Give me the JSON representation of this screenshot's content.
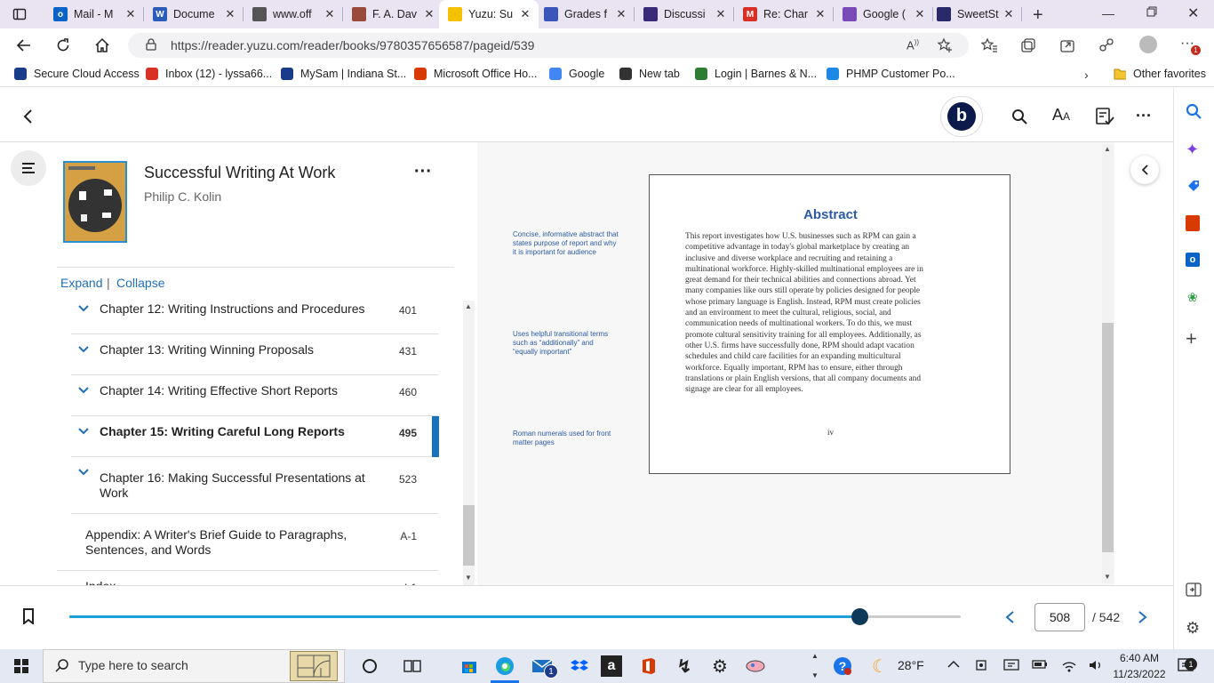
{
  "browser": {
    "tabs": [
      {
        "title": "Mail - M",
        "color": "#0a64c8",
        "glyph": "o"
      },
      {
        "title": "Docume",
        "color": "#2b5cb8",
        "glyph": "W"
      },
      {
        "title": "www.off",
        "color": "#555555",
        "glyph": ""
      },
      {
        "title": "F. A. Dav",
        "color": "#9a4a3a",
        "glyph": ""
      },
      {
        "title": "Yuzu: Su",
        "color": "#f2c200",
        "glyph": ""
      },
      {
        "title": "Grades f",
        "color": "#3a56b8",
        "glyph": ""
      },
      {
        "title": "Discussi",
        "color": "#3a2a7a",
        "glyph": ""
      },
      {
        "title": "Re: Char",
        "color": "#d93025",
        "glyph": "M"
      },
      {
        "title": "Google (",
        "color": "#7a4ab8",
        "glyph": ""
      },
      {
        "title": "SweetSt",
        "color": "#2a2a6a",
        "glyph": ""
      }
    ],
    "address": "https://reader.yuzu.com/reader/books/9780357656587/pageid/539",
    "favorites": [
      {
        "label": "Secure Cloud Access",
        "color": "#1a3a8a"
      },
      {
        "label": "Inbox (12) - lyssa66...",
        "color": "#d93025"
      },
      {
        "label": "MySam | Indiana St...",
        "color": "#1a3a8a"
      },
      {
        "label": "Microsoft Office Ho...",
        "color": "#d83b01"
      },
      {
        "label": "Google",
        "color": "#4285f4"
      },
      {
        "label": "New tab",
        "color": "#333333"
      },
      {
        "label": "Login | Barnes & N...",
        "color": "#2e7d32"
      },
      {
        "label": "PHMP Customer Po...",
        "color": "#1e88e5"
      }
    ],
    "other_favorites": "Other favorites",
    "profile_badge": "1"
  },
  "reader": {
    "book_title": "Successful Writing At Work",
    "author": "Philip C. Kolin",
    "avatar_letter": "b",
    "expand": "Expand",
    "collapse": "Collapse",
    "divider": "|",
    "toc": [
      {
        "label": "Chapter 12: Writing Instructions and Procedures",
        "page": "401",
        "active": false
      },
      {
        "label": "Chapter 13: Writing Winning Proposals",
        "page": "431",
        "active": false
      },
      {
        "label": "Chapter 14: Writing Effective Short Reports",
        "page": "460",
        "active": false
      },
      {
        "label": "Chapter 15: Writing Careful Long Reports",
        "page": "495",
        "active": true
      },
      {
        "label": "Chapter 16: Making Successful Presentations at Work",
        "page": "523",
        "active": false
      },
      {
        "label": "Appendix: A Writer's Brief Guide to Paragraphs, Sentences, and Words",
        "page": "A-1",
        "active": false
      },
      {
        "label": "Index",
        "page": "I-1",
        "active": false
      }
    ],
    "page_content": {
      "heading": "Abstract",
      "lines": [
        "This report investigates how U.S. businesses such as RPM can gain a",
        "competitive advantage in today's global marketplace by creating an",
        "inclusive and diverse workplace and recruiting and retaining a",
        "multinational workforce. Highly-skilled multinational employees are in",
        "great demand for their technical abilities and connections abroad. Yet",
        "many companies like ours still operate by policies designed for people",
        "whose primary language is English. Instead, RPM must create policies",
        "and an environment to meet the cultural, religious, social, and",
        "communication needs of multinational workers. To do this, we must",
        "promote cultural sensitivity training for all employees. Additionally, as",
        "other U.S. firms have successfully done, RPM should adapt vacation",
        "schedules and child care facilities for an expanding multicultural",
        "workforce. Equally important, RPM has to ensure, either through",
        "translations or plain English versions, that all company documents and",
        "signage are clear for all employees."
      ],
      "page_numeral": "iv",
      "notes": [
        [
          "Concise, informative abstract that",
          "states purpose of report and why",
          "it is important for audience"
        ],
        [
          "Uses helpful transitional terms",
          "such as “additionally” and",
          "“equally important”"
        ],
        [
          "Roman numerals used for front",
          "matter pages"
        ]
      ]
    },
    "progress": {
      "current_page": "508",
      "total_label": "/ 542",
      "fraction": 0.886
    }
  },
  "taskbar": {
    "search_placeholder": "Type here to search",
    "weather": "28°F",
    "time": "6:40 AM",
    "date": "11/23/2022",
    "notifications": "1",
    "mail_badge": "1"
  }
}
